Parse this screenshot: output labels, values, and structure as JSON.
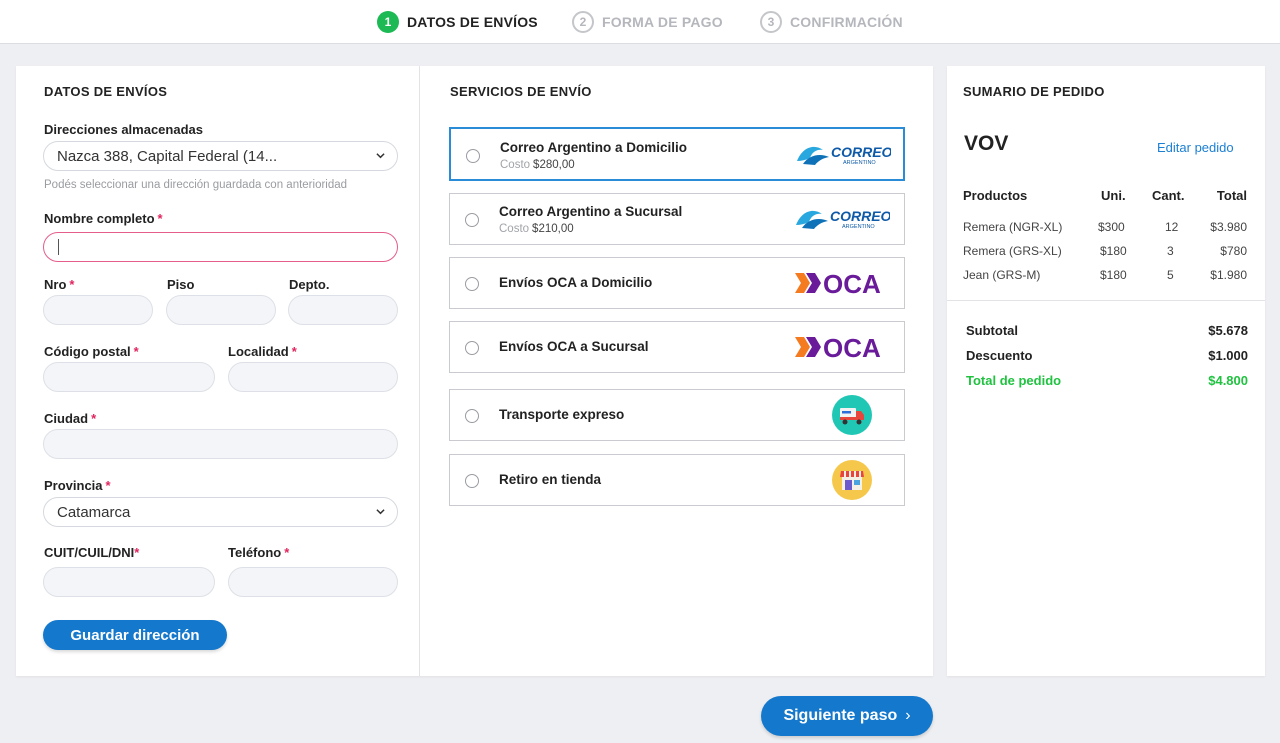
{
  "steps": [
    {
      "num": "1",
      "label": "DATOS DE ENVÍOS"
    },
    {
      "num": "2",
      "label": "FORMA DE PAGO"
    },
    {
      "num": "3",
      "label": "CONFIRMACIÓN"
    }
  ],
  "shipping_form": {
    "title": "DATOS DE ENVÍOS",
    "stored_label": "Direcciones almacenadas",
    "stored_value": "Nazca 388, Capital Federal (14...",
    "stored_hint": "Podés seleccionar una dirección guardada con anterioridad",
    "full_name_label": "Nombre completo",
    "nro_label": "Nro",
    "piso_label": "Piso",
    "depto_label": "Depto.",
    "postal_label": "Código postal",
    "locality_label": "Localidad",
    "city_label": "Ciudad",
    "province_label": "Provincia",
    "province_value": "Catamarca",
    "id_label": "CUIT/CUIL/DNI",
    "phone_label": "Teléfono",
    "required_mark": "*",
    "save_button": "Guardar dirección"
  },
  "services": {
    "title": "SERVICIOS DE ENVÍO",
    "cost_label": "Costo",
    "logo_correo_text": "CORREO",
    "logo_correo_sub": "ARGENTINO",
    "logo_oca_text": "OCA",
    "items": [
      {
        "name": "Correo Argentino a Domicilio",
        "cost": "$280,00",
        "logo": "correo-argentino-logo"
      },
      {
        "name": "Correo Argentino a Sucursal",
        "cost": "$210,00",
        "logo": "correo-argentino-logo"
      },
      {
        "name": "Envíos OCA a Domicilio",
        "logo": "oca-logo"
      },
      {
        "name": "Envíos OCA a Sucursal",
        "logo": "oca-logo"
      },
      {
        "name": "Transporte expreso",
        "logo": "delivery-truck-icon"
      },
      {
        "name": "Retiro en tienda",
        "logo": "store-icon"
      }
    ]
  },
  "summary": {
    "title": "SUMARIO DE PEDIDO",
    "order_name": "VOV",
    "edit_link": "Editar pedido",
    "headers": {
      "product": "Productos",
      "unit": "Uni.",
      "qty": "Cant.",
      "total": "Total"
    },
    "rows": [
      {
        "product": "Remera (NGR-XL)",
        "unit": "$300",
        "qty": "12",
        "total": "$3.980"
      },
      {
        "product": "Remera (GRS-XL)",
        "unit": "$180",
        "qty": "3",
        "total": "$780"
      },
      {
        "product": "Jean (GRS-M)",
        "unit": "$180",
        "qty": "5",
        "total": "$1.980"
      }
    ],
    "subtotal_label": "Subtotal",
    "subtotal_value": "$5.678",
    "discount_label": "Descuento",
    "discount_value": "$1.000",
    "total_label": "Total de pedido",
    "total_value": "$4.800",
    "total_color": "#20c240"
  },
  "next_button": "Siguiente paso",
  "colors": {
    "primary": "#1478cc",
    "step_active": "#1db954",
    "required": "#e0245e",
    "oca_purple": "#6a1b9a",
    "oca_orange": "#f47b20"
  }
}
